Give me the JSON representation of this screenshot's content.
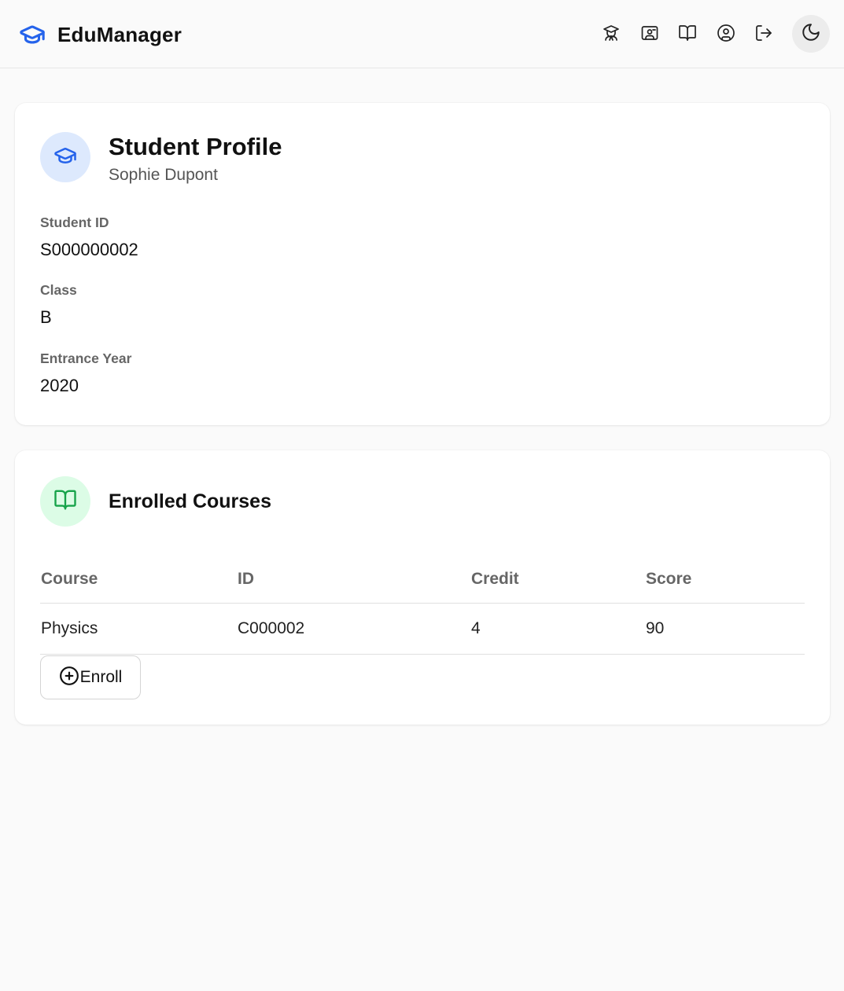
{
  "app": {
    "title": "EduManager"
  },
  "nav": {
    "items": [
      {
        "name": "students",
        "icon": "graduation-teacher-icon"
      },
      {
        "name": "teachers",
        "icon": "presentation-board-icon"
      },
      {
        "name": "courses",
        "icon": "book-open-icon"
      },
      {
        "name": "profile",
        "icon": "user-circle-icon"
      },
      {
        "name": "logout",
        "icon": "logout-icon"
      }
    ],
    "theme_toggle_icon": "moon-icon"
  },
  "profile": {
    "heading": "Student Profile",
    "name": "Sophie Dupont",
    "fields": [
      {
        "label": "Student ID",
        "value": "S000000002"
      },
      {
        "label": "Class",
        "value": "B"
      },
      {
        "label": "Entrance Year",
        "value": "2020"
      }
    ]
  },
  "courses": {
    "heading": "Enrolled Courses",
    "columns": [
      "Course",
      "ID",
      "Credit",
      "Score"
    ],
    "rows": [
      [
        "Physics",
        "C000002",
        "4",
        "90"
      ]
    ],
    "enroll_label": "Enroll"
  },
  "colors": {
    "brand_blue": "#2563eb",
    "course_green": "#16a34a",
    "profile_avatar_bg": "#dde9fd",
    "courses_avatar_bg": "#dcfce6"
  }
}
